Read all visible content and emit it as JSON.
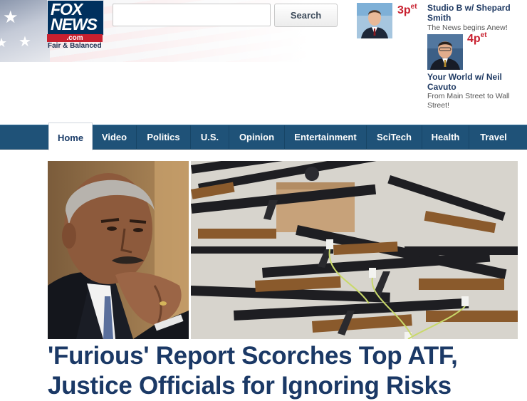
{
  "logo": {
    "line1": "FOX",
    "line2": "NEWS",
    "dotcom": ".com",
    "tagline": "Fair & Balanced"
  },
  "search": {
    "placeholder": "",
    "value": "",
    "button_label": "Search"
  },
  "shows": [
    {
      "time": "3p",
      "time_suffix": "et",
      "title": "Studio B w/ Shepard Smith",
      "description": "The News begins Anew!"
    },
    {
      "time": "4p",
      "time_suffix": "et",
      "title": "Your World w/ Neil Cavuto",
      "description": "From Main Street to Wall Street!"
    }
  ],
  "nav": {
    "items": [
      {
        "label": "Home",
        "active": true
      },
      {
        "label": "Video"
      },
      {
        "label": "Politics"
      },
      {
        "label": "U.S."
      },
      {
        "label": "Opinion"
      },
      {
        "label": "Entertainment"
      },
      {
        "label": "SciTech"
      },
      {
        "label": "Health"
      },
      {
        "label": "Travel"
      }
    ]
  },
  "story": {
    "headline": "'Furious' Report Scorches Top ATF, Justice Officials for Ignoring Risks"
  },
  "colors": {
    "nav_bg": "#1f5278",
    "brand_navy": "#00305e",
    "brand_red": "#c8202f",
    "headline": "#1b3966"
  }
}
